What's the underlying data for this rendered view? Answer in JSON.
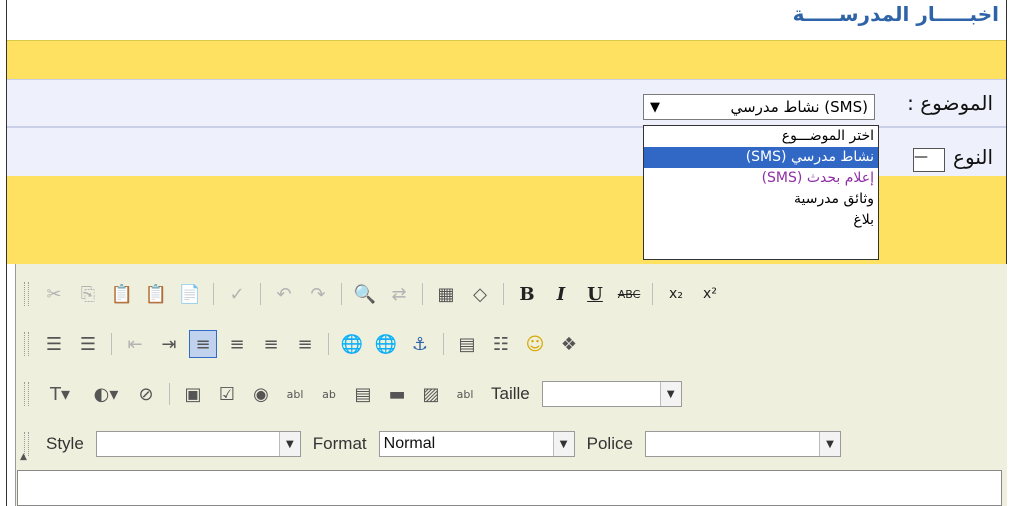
{
  "page": {
    "title": "اخبـــــار المدرســـــة"
  },
  "form": {
    "subject_label": "الموضوع :",
    "subject_value": "نشاط مدرسي (SMS)",
    "type_label": "النوع :",
    "type_value": "—"
  },
  "dropdown": {
    "options": [
      "اختر الموضـــوع",
      "نشاط مدرسي (SMS)",
      "إعلام بحدث (SMS)",
      "وثائق مدرسية",
      "بلاغ"
    ],
    "selected_index": 1
  },
  "toolbar": {
    "size_label": "Taille",
    "size_value": "",
    "style_label": "Style",
    "style_value": "",
    "format_label": "Format",
    "format_value": "Normal",
    "font_label": "Police",
    "font_value": ""
  },
  "icons": {
    "row1": [
      "cut-icon",
      "copy-icon",
      "paste-icon",
      "paste-text-icon",
      "paste-word-icon",
      "spellcheck-icon",
      "undo-icon",
      "redo-icon",
      "find-icon",
      "replace-icon",
      "select-all-icon",
      "remove-format-icon",
      "bold-icon",
      "italic-icon",
      "underline-icon",
      "strikethrough-icon",
      "subscript-icon",
      "superscript-icon"
    ],
    "row2": [
      "numbered-list-icon",
      "bulleted-list-icon",
      "outdent-icon",
      "indent-icon",
      "align-left-icon",
      "align-center-icon",
      "align-right-icon",
      "justify-icon",
      "link-icon",
      "unlink-icon",
      "anchor-icon",
      "table-icon",
      "horizontal-rule-icon",
      "smiley-icon",
      "special-char-icon"
    ]
  },
  "colors": {
    "accent_yellow": "#ffe162",
    "title_blue": "#2e63a8",
    "selection_blue": "#3168c6",
    "purple_option": "#8e2fa5"
  }
}
